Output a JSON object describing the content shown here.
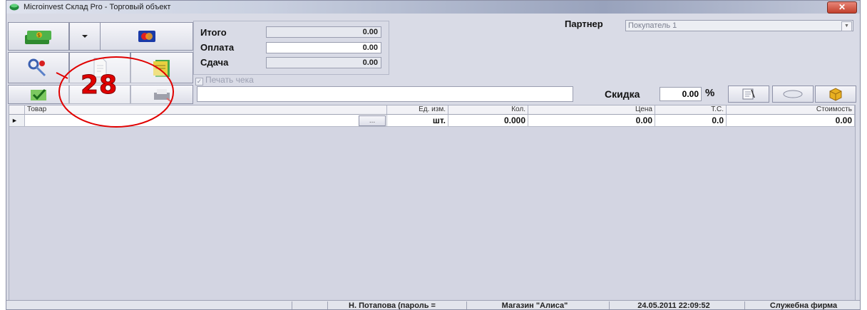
{
  "window": {
    "title": "Microinvest Склад Pro - Торговый объект",
    "close_label": "✕"
  },
  "totals": {
    "total_label": "Итого",
    "total_value": "0.00",
    "payment_label": "Оплата",
    "payment_value": "0.00",
    "change_label": "Сдача",
    "change_value": "0.00"
  },
  "partner": {
    "label": "Партнер",
    "value": "Покупатель 1"
  },
  "print_receipt": {
    "label": "Печать чека",
    "checked": true
  },
  "discount": {
    "label": "Скидка",
    "value": "0.00",
    "unit": "%"
  },
  "grid": {
    "columns": [
      "Товар",
      "Ед. изм.",
      "Кол.",
      "Цена",
      "Т.С.",
      "Стоимость"
    ],
    "row": {
      "marker": "►",
      "item": "",
      "browse": "...",
      "unit": "шт.",
      "qty": "0.000",
      "price": "0.00",
      "vat": "0.0",
      "amount": "0.00"
    }
  },
  "overlay": {
    "badge": "28"
  },
  "statusbar": {
    "user": "Н. Потапова (пароль =",
    "store": "Магазин \"Алиса\"",
    "datetime": "24.05.2011 22:09:52",
    "company": "Служебна фирма"
  },
  "colors": {
    "window_bg": "#d9dbe6",
    "grid_bg": "#d3d5e2",
    "title_close": "#c2402c",
    "overlay_red": "#e00000"
  },
  "icons": [
    "cash-icon",
    "card-icon",
    "keys-icon",
    "document-icon",
    "notes-icon",
    "check-icon",
    "print-icon",
    "notepad-icon",
    "eraser-icon",
    "box-icon"
  ]
}
